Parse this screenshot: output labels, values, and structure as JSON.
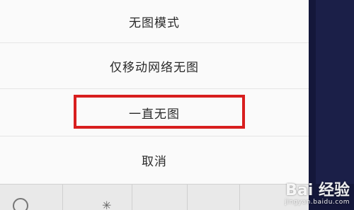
{
  "sheet": {
    "items": [
      {
        "label": "无图模式"
      },
      {
        "label": "仅移动网络无图"
      },
      {
        "label": "一直无图"
      },
      {
        "label": "取消"
      }
    ],
    "highlighted_index": 2
  },
  "colors": {
    "highlight": "#d81e1e",
    "right_strip": "#14173a"
  },
  "toolbar": {
    "icons": [
      "circle-icon",
      "sun-icon"
    ]
  },
  "watermark": {
    "logo": "Bai 经验",
    "url": "jingyan.baidu.com"
  }
}
